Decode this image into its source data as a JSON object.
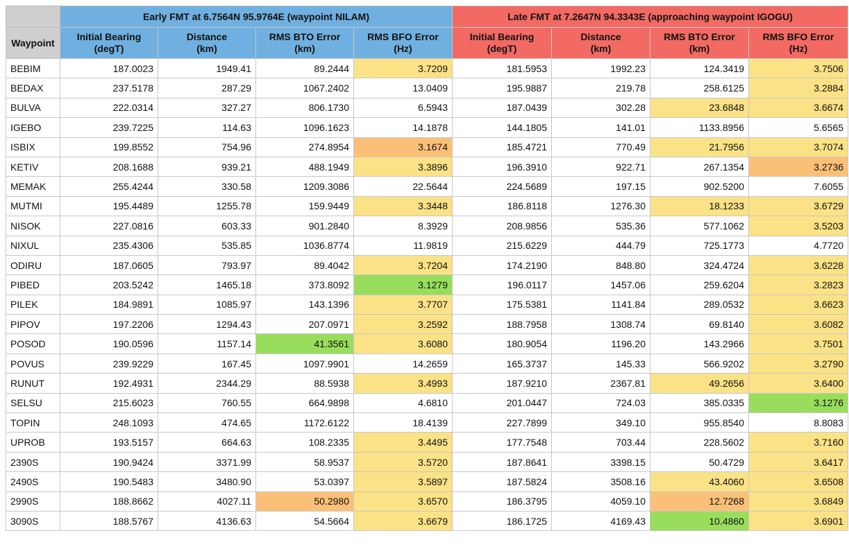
{
  "groups": {
    "early": "Early FMT at 6.7564N 95.9764E (waypoint NILAM)",
    "late": "Late FMT at 7.2647N 94.3343E (approaching waypoint IGOGU)"
  },
  "columns": {
    "waypoint": "Waypoint",
    "early_bearing": [
      "Initial Bearing",
      "(degT)"
    ],
    "early_distance": [
      "Distance",
      "(km)"
    ],
    "early_bto": [
      "RMS BTO Error",
      "(km)"
    ],
    "early_bfo": [
      "RMS BFO Error",
      "(Hz)"
    ],
    "late_bearing": [
      "Initial Bearing",
      "(degT)"
    ],
    "late_distance": [
      "Distance",
      "(km)"
    ],
    "late_bto": [
      "RMS BTO Error",
      "(km)"
    ],
    "late_bfo": [
      "RMS BFO Error",
      "(Hz)"
    ]
  },
  "highlight_colors": {
    "yellow": "#fbe286",
    "orange": "#fbc078",
    "green": "#98de5c",
    "early_header": "#6fb0e0",
    "late_header": "#f26a63"
  },
  "rows": [
    {
      "waypoint": "BEBIM",
      "e_bearing": "187.0023",
      "e_dist": "1949.41",
      "e_bto": "89.2444",
      "e_bfo": "3.7209",
      "l_bearing": "181.5953",
      "l_dist": "1992.23",
      "l_bto": "124.3419",
      "l_bfo": "3.7506",
      "hl": {
        "e_bfo": "yellow",
        "l_bfo": "yellow"
      }
    },
    {
      "waypoint": "BEDAX",
      "e_bearing": "237.5178",
      "e_dist": "287.29",
      "e_bto": "1067.2402",
      "e_bfo": "13.0409",
      "l_bearing": "195.9887",
      "l_dist": "219.78",
      "l_bto": "258.6125",
      "l_bfo": "3.2884",
      "hl": {
        "l_bfo": "yellow"
      }
    },
    {
      "waypoint": "BULVA",
      "e_bearing": "222.0314",
      "e_dist": "327.27",
      "e_bto": "806.1730",
      "e_bfo": "6.5943",
      "l_bearing": "187.0439",
      "l_dist": "302.28",
      "l_bto": "23.6848",
      "l_bfo": "3.6674",
      "hl": {
        "l_bto": "yellow",
        "l_bfo": "yellow"
      }
    },
    {
      "waypoint": "IGEBO",
      "e_bearing": "239.7225",
      "e_dist": "114.63",
      "e_bto": "1096.1623",
      "e_bfo": "14.1878",
      "l_bearing": "144.1805",
      "l_dist": "141.01",
      "l_bto": "1133.8956",
      "l_bfo": "5.6565",
      "hl": {}
    },
    {
      "waypoint": "ISBIX",
      "e_bearing": "199.8552",
      "e_dist": "754.96",
      "e_bto": "274.8954",
      "e_bfo": "3.1674",
      "l_bearing": "185.4721",
      "l_dist": "770.49",
      "l_bto": "21.7956",
      "l_bfo": "3.7074",
      "hl": {
        "e_bfo": "orange",
        "l_bto": "yellow",
        "l_bfo": "yellow"
      }
    },
    {
      "waypoint": "KETIV",
      "e_bearing": "208.1688",
      "e_dist": "939.21",
      "e_bto": "488.1949",
      "e_bfo": "3.3896",
      "l_bearing": "196.3910",
      "l_dist": "922.71",
      "l_bto": "267.1354",
      "l_bfo": "3.2736",
      "hl": {
        "e_bfo": "yellow",
        "l_bfo": "orange"
      }
    },
    {
      "waypoint": "MEMAK",
      "e_bearing": "255.4244",
      "e_dist": "330.58",
      "e_bto": "1209.3086",
      "e_bfo": "22.5644",
      "l_bearing": "224.5689",
      "l_dist": "197.15",
      "l_bto": "902.5200",
      "l_bfo": "7.6055",
      "hl": {}
    },
    {
      "waypoint": "MUTMI",
      "e_bearing": "195.4489",
      "e_dist": "1255.78",
      "e_bto": "159.9449",
      "e_bfo": "3.3448",
      "l_bearing": "186.8118",
      "l_dist": "1276.30",
      "l_bto": "18.1233",
      "l_bfo": "3.6729",
      "hl": {
        "e_bfo": "yellow",
        "l_bto": "yellow",
        "l_bfo": "yellow"
      }
    },
    {
      "waypoint": "NISOK",
      "e_bearing": "227.0816",
      "e_dist": "603.33",
      "e_bto": "901.2840",
      "e_bfo": "8.3929",
      "l_bearing": "208.9856",
      "l_dist": "535.36",
      "l_bto": "577.1062",
      "l_bfo": "3.5203",
      "hl": {
        "l_bfo": "yellow"
      }
    },
    {
      "waypoint": "NIXUL",
      "e_bearing": "235.4306",
      "e_dist": "535.85",
      "e_bto": "1036.8774",
      "e_bfo": "11.9819",
      "l_bearing": "215.6229",
      "l_dist": "444.79",
      "l_bto": "725.1773",
      "l_bfo": "4.7720",
      "hl": {}
    },
    {
      "waypoint": "ODIRU",
      "e_bearing": "187.0605",
      "e_dist": "793.97",
      "e_bto": "89.4042",
      "e_bfo": "3.7204",
      "l_bearing": "174.2190",
      "l_dist": "848.80",
      "l_bto": "324.4724",
      "l_bfo": "3.6228",
      "hl": {
        "e_bfo": "yellow",
        "l_bfo": "yellow"
      }
    },
    {
      "waypoint": "PIBED",
      "e_bearing": "203.5242",
      "e_dist": "1465.18",
      "e_bto": "373.8092",
      "e_bfo": "3.1279",
      "l_bearing": "196.0117",
      "l_dist": "1457.06",
      "l_bto": "259.6204",
      "l_bfo": "3.2823",
      "hl": {
        "e_bfo": "green",
        "l_bfo": "yellow"
      }
    },
    {
      "waypoint": "PILEK",
      "e_bearing": "184.9891",
      "e_dist": "1085.97",
      "e_bto": "143.1396",
      "e_bfo": "3.7707",
      "l_bearing": "175.5381",
      "l_dist": "1141.84",
      "l_bto": "289.0532",
      "l_bfo": "3.6623",
      "hl": {
        "e_bfo": "yellow",
        "l_bfo": "yellow"
      }
    },
    {
      "waypoint": "PIPOV",
      "e_bearing": "197.2206",
      "e_dist": "1294.43",
      "e_bto": "207.0971",
      "e_bfo": "3.2592",
      "l_bearing": "188.7958",
      "l_dist": "1308.74",
      "l_bto": "69.8140",
      "l_bfo": "3.6082",
      "hl": {
        "e_bfo": "yellow",
        "l_bfo": "yellow"
      }
    },
    {
      "waypoint": "POSOD",
      "e_bearing": "190.0596",
      "e_dist": "1157.14",
      "e_bto": "41.3561",
      "e_bfo": "3.6080",
      "l_bearing": "180.9054",
      "l_dist": "1196.20",
      "l_bto": "143.2966",
      "l_bfo": "3.7501",
      "hl": {
        "e_bto": "green",
        "e_bfo": "yellow",
        "l_bfo": "yellow"
      }
    },
    {
      "waypoint": "POVUS",
      "e_bearing": "239.9229",
      "e_dist": "167.45",
      "e_bto": "1097.9901",
      "e_bfo": "14.2659",
      "l_bearing": "165.3737",
      "l_dist": "145.33",
      "l_bto": "566.9202",
      "l_bfo": "3.2790",
      "hl": {
        "l_bfo": "yellow"
      }
    },
    {
      "waypoint": "RUNUT",
      "e_bearing": "192.4931",
      "e_dist": "2344.29",
      "e_bto": "88.5938",
      "e_bfo": "3.4993",
      "l_bearing": "187.9210",
      "l_dist": "2367.81",
      "l_bto": "49.2656",
      "l_bfo": "3.6400",
      "hl": {
        "e_bfo": "yellow",
        "l_bto": "yellow",
        "l_bfo": "yellow"
      }
    },
    {
      "waypoint": "SELSU",
      "e_bearing": "215.6023",
      "e_dist": "760.55",
      "e_bto": "664.9898",
      "e_bfo": "4.6810",
      "l_bearing": "201.0447",
      "l_dist": "724.03",
      "l_bto": "385.0335",
      "l_bfo": "3.1276",
      "hl": {
        "l_bfo": "green"
      }
    },
    {
      "waypoint": "TOPIN",
      "e_bearing": "248.1093",
      "e_dist": "474.65",
      "e_bto": "1172.6122",
      "e_bfo": "18.4139",
      "l_bearing": "227.7899",
      "l_dist": "349.10",
      "l_bto": "955.8540",
      "l_bfo": "8.8083",
      "hl": {}
    },
    {
      "waypoint": "UPROB",
      "e_bearing": "193.5157",
      "e_dist": "664.63",
      "e_bto": "108.2335",
      "e_bfo": "3.4495",
      "l_bearing": "177.7548",
      "l_dist": "703.44",
      "l_bto": "228.5602",
      "l_bfo": "3.7160",
      "hl": {
        "e_bfo": "yellow",
        "l_bfo": "yellow"
      }
    },
    {
      "waypoint": "2390S",
      "e_bearing": "190.9424",
      "e_dist": "3371.99",
      "e_bto": "58.9537",
      "e_bfo": "3.5720",
      "l_bearing": "187.8641",
      "l_dist": "3398.15",
      "l_bto": "50.4729",
      "l_bfo": "3.6417",
      "hl": {
        "e_bfo": "yellow",
        "l_bfo": "yellow"
      }
    },
    {
      "waypoint": "2490S",
      "e_bearing": "190.5483",
      "e_dist": "3480.90",
      "e_bto": "53.0397",
      "e_bfo": "3.5897",
      "l_bearing": "187.5824",
      "l_dist": "3508.16",
      "l_bto": "43.4060",
      "l_bfo": "3.6508",
      "hl": {
        "e_bfo": "yellow",
        "l_bto": "yellow",
        "l_bfo": "yellow"
      }
    },
    {
      "waypoint": "2990S",
      "e_bearing": "188.8662",
      "e_dist": "4027.11",
      "e_bto": "50.2980",
      "e_bfo": "3.6570",
      "l_bearing": "186.3795",
      "l_dist": "4059.10",
      "l_bto": "12.7268",
      "l_bfo": "3.6849",
      "hl": {
        "e_bto": "orange",
        "e_bfo": "yellow",
        "l_bto": "orange",
        "l_bfo": "yellow"
      }
    },
    {
      "waypoint": "3090S",
      "e_bearing": "188.5767",
      "e_dist": "4136.63",
      "e_bto": "54.5664",
      "e_bfo": "3.6679",
      "l_bearing": "186.1725",
      "l_dist": "4169.43",
      "l_bto": "10.4860",
      "l_bfo": "3.6901",
      "hl": {
        "e_bfo": "yellow",
        "l_bto": "green",
        "l_bfo": "yellow"
      }
    }
  ]
}
